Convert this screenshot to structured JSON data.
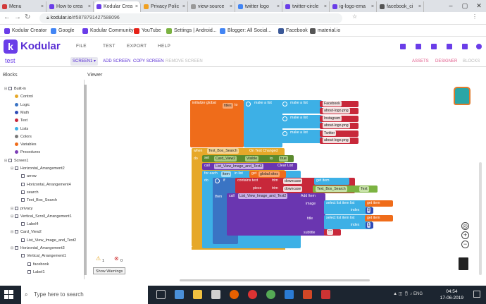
{
  "browser": {
    "tabs": [
      {
        "label": "Menu",
        "color": "#d23b3b",
        "active": false
      },
      {
        "label": "How to crea",
        "color": "#6a3de8",
        "active": false
      },
      {
        "label": "Kodular Crea",
        "color": "#6a3de8",
        "active": true
      },
      {
        "label": "Privacy Polic",
        "color": "#f0a020",
        "active": false
      },
      {
        "label": "view-source",
        "color": "#999999",
        "active": false
      },
      {
        "label": "twitter logo",
        "color": "#4285f4",
        "active": false
      },
      {
        "label": "twitter-circle",
        "color": "#6a3de8",
        "active": false
      },
      {
        "label": "ig-logo-ema",
        "color": "#6a3de8",
        "active": false
      },
      {
        "label": "facebook_ci",
        "color": "#555555",
        "active": false
      }
    ],
    "url_domain": "kodular.io",
    "url_rest": "/#5878791427588096",
    "bookmarks": [
      {
        "label": "Kodular Creator",
        "color": "#6a3de8"
      },
      {
        "label": "Google",
        "color": "#4285f4"
      },
      {
        "label": "Kodular Community",
        "color": "#6a3de8"
      },
      {
        "label": "YouTube",
        "color": "#e62117"
      },
      {
        "label": "Settings | Android...",
        "color": "#7cb342"
      },
      {
        "label": "Blogger: All Social...",
        "color": "#4285f4"
      },
      {
        "label": "Facebook",
        "color": "#3b5998"
      },
      {
        "label": "material.io",
        "color": "#555555"
      }
    ]
  },
  "app": {
    "logo": "Kodular",
    "menu": [
      "FILE",
      "TEST",
      "EXPORT",
      "HELP"
    ],
    "project": "test",
    "screen_select": "SCREEN1 ▾",
    "toolbar": {
      "add": "ADD SCREEN",
      "copy": "COPY SCREEN",
      "remove": "REMOVE SCREEN"
    },
    "right": {
      "assets": "ASSETS",
      "designer": "DESIGNER",
      "blocks": "BLOCKS"
    },
    "blocks_label": "Blocks",
    "viewer_label": "Viewer"
  },
  "tree": [
    {
      "label": "Built-in",
      "depth": 0,
      "kind": "toggle"
    },
    {
      "label": "Control",
      "depth": 1,
      "kind": "dot",
      "color": "#e6a829"
    },
    {
      "label": "Logic",
      "depth": 1,
      "kind": "dot",
      "color": "#3a74c4"
    },
    {
      "label": "Math",
      "depth": 1,
      "kind": "dot",
      "color": "#2f4bb6"
    },
    {
      "label": "Text",
      "depth": 1,
      "kind": "dot",
      "color": "#c8283a"
    },
    {
      "label": "Lists",
      "depth": 1,
      "kind": "dot",
      "color": "#3db0e6"
    },
    {
      "label": "Colors",
      "depth": 1,
      "kind": "dot",
      "color": "#7a7a7a"
    },
    {
      "label": "Variables",
      "depth": 1,
      "kind": "dot",
      "color": "#ef6c1a"
    },
    {
      "label": "Procedures",
      "depth": 1,
      "kind": "dot",
      "color": "#7b3db6"
    },
    {
      "label": "Screen1",
      "depth": 0,
      "kind": "comp"
    },
    {
      "label": "Horizontal_Arrangement2",
      "depth": 1,
      "kind": "comp"
    },
    {
      "label": "arrow",
      "depth": 2,
      "kind": "comp"
    },
    {
      "label": "Horizontal_Arrangement4",
      "depth": 2,
      "kind": "comp"
    },
    {
      "label": "search",
      "depth": 2,
      "kind": "comp"
    },
    {
      "label": "Text_Box_Search",
      "depth": 2,
      "kind": "comp"
    },
    {
      "label": "privacy",
      "depth": 1,
      "kind": "comp"
    },
    {
      "label": "Vertical_Scroll_Arrangement1",
      "depth": 1,
      "kind": "comp"
    },
    {
      "label": "Label4",
      "depth": 2,
      "kind": "comp"
    },
    {
      "label": "Card_View2",
      "depth": 1,
      "kind": "comp"
    },
    {
      "label": "List_View_Image_and_Text2",
      "depth": 2,
      "kind": "comp"
    },
    {
      "label": "Horizontal_Arrangement3",
      "depth": 1,
      "kind": "comp"
    },
    {
      "label": "Vertical_Arrangement1",
      "depth": 2,
      "kind": "comp"
    },
    {
      "label": "facebook",
      "depth": 3,
      "kind": "comp"
    },
    {
      "label": "Label1",
      "depth": 3,
      "kind": "comp"
    }
  ],
  "blocks": {
    "init_global": "initialize global",
    "var_titles": "titles",
    "to": "to",
    "make_list": "make a list",
    "items": [
      "Facebook",
      "about-logo.png",
      "Instagram",
      "about-logo.png",
      "Twitter",
      "about-logo.png"
    ],
    "when": "when",
    "tb_search": "Text_Box_Search",
    "on_text_changed": "On Text Changed",
    "do": "do",
    "set": "set",
    "card_view": "Card_View2",
    "visible": "Visible",
    "true_val": "true",
    "call": "call",
    "lv_dot": "List_View_Image_and_Text2",
    "clear_list": "Clear List",
    "for_each": "for each",
    "item": "item",
    "in_list": "in list",
    "get": "get",
    "global_sites": "global sites",
    "if": "if",
    "contains_text": "contains  text",
    "trim": "trim",
    "downcase": "downcase",
    "get_item": "get  item",
    "piece": "piece",
    "text_prop": "Text",
    "then": "then",
    "add_item": "Add Item",
    "image": "image",
    "select_item": "select list item  list",
    "index": "index",
    "idx1": "2",
    "title": "title",
    "idx2": "1",
    "subtitle": "subtitle",
    "empty_str": "\" \""
  },
  "warnings": {
    "w_count": "1",
    "e_count": "0",
    "show": "Show Warnings"
  },
  "taskbar": {
    "search": "Type here to search",
    "time": "04:54",
    "date": "17-06-2019",
    "lang": "ENG"
  }
}
